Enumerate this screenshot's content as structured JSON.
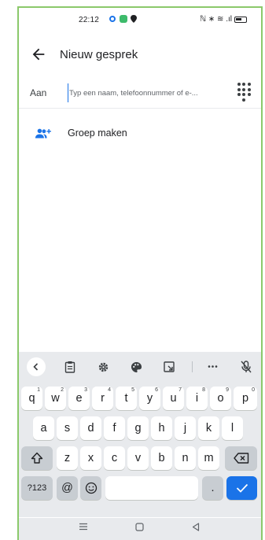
{
  "status_bar": {
    "time": "22:12",
    "right_text": "ℕ ∗ ≋ .ıl"
  },
  "app_bar": {
    "title": "Nieuw gesprek"
  },
  "recipient": {
    "label": "Aan",
    "placeholder": "Typ een naam, telefoonnummer of e-..."
  },
  "group_option": {
    "label": "Groep maken"
  },
  "keyboard": {
    "row1": [
      {
        "k": "q",
        "sup": "1"
      },
      {
        "k": "w",
        "sup": "2"
      },
      {
        "k": "e",
        "sup": "3"
      },
      {
        "k": "r",
        "sup": "4"
      },
      {
        "k": "t",
        "sup": "5"
      },
      {
        "k": "y",
        "sup": "6"
      },
      {
        "k": "u",
        "sup": "7"
      },
      {
        "k": "i",
        "sup": "8"
      },
      {
        "k": "o",
        "sup": "9"
      },
      {
        "k": "p",
        "sup": "0"
      }
    ],
    "row2": [
      "a",
      "s",
      "d",
      "f",
      "g",
      "h",
      "j",
      "k",
      "l"
    ],
    "row3": [
      "z",
      "x",
      "c",
      "v",
      "b",
      "n",
      "m"
    ],
    "symbols_label": "?123",
    "at_label": "@",
    "period_label": ".",
    "toolbar_more": "•••"
  },
  "colors": {
    "accent": "#1a73e8",
    "frame_border": "#8bc96b",
    "keyboard_bg": "#e8eaed"
  }
}
